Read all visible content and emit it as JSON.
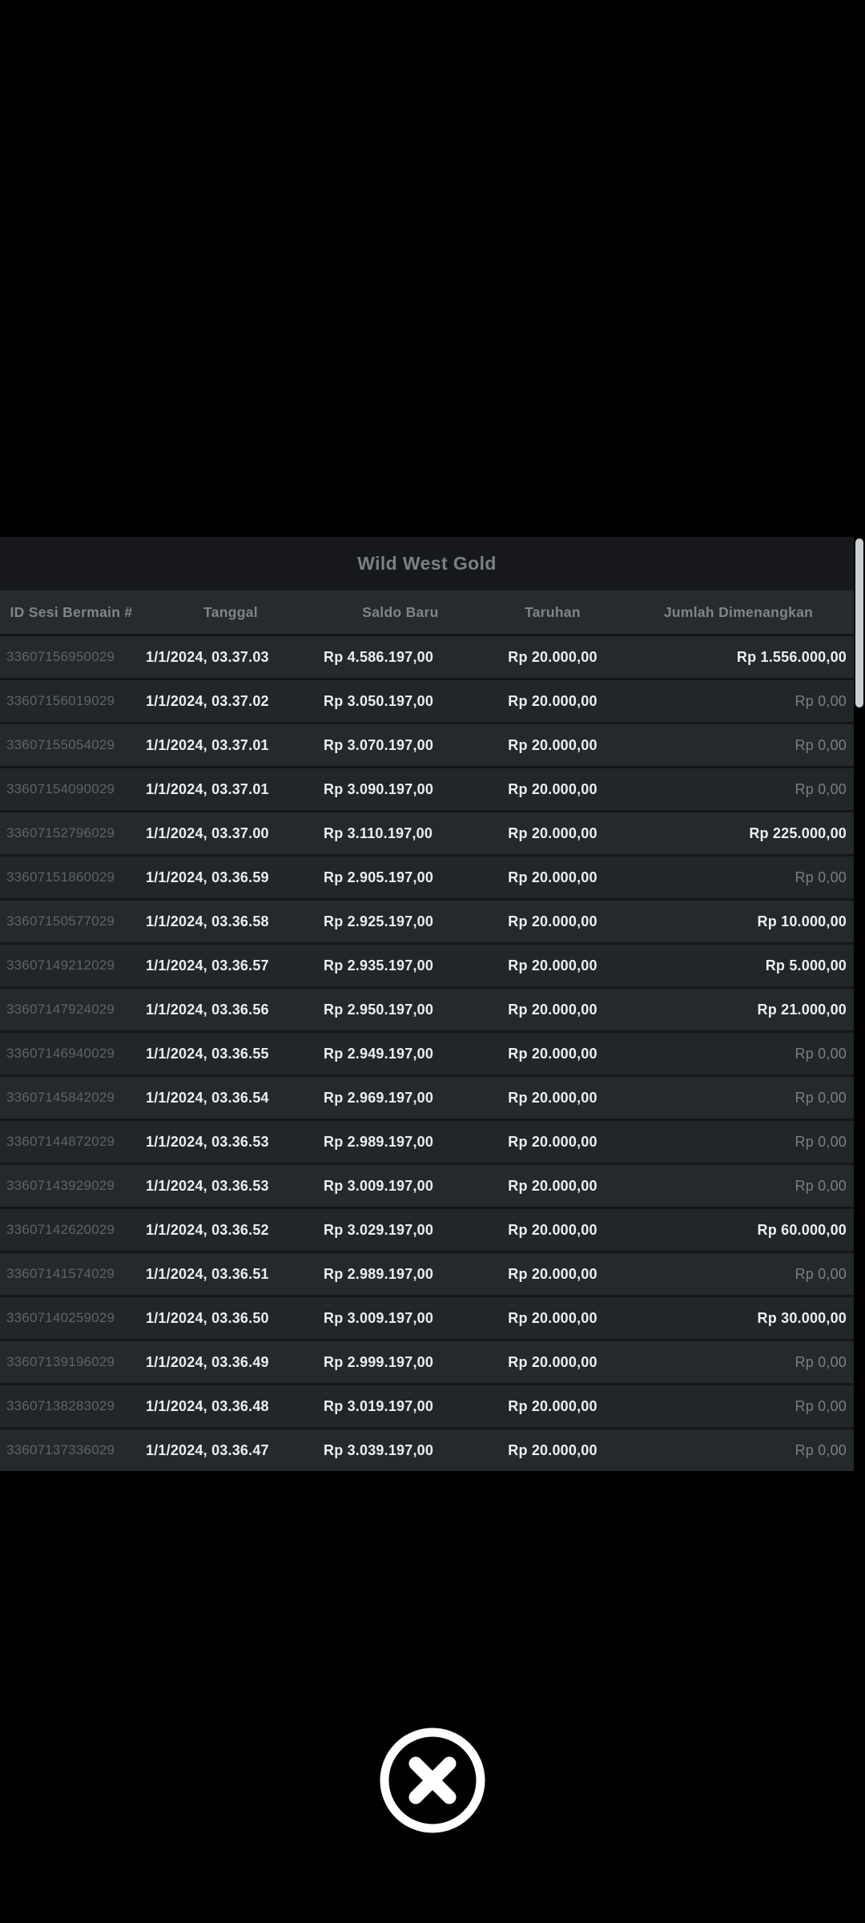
{
  "modal": {
    "title": "Wild West Gold",
    "columns": [
      "ID Sesi Bermain #",
      "Tanggal",
      "Saldo Baru",
      "Taruhan",
      "Jumlah Dimenangkan"
    ],
    "rows": [
      {
        "id": "33607156950029",
        "date": "1/1/2024, 03.37.03",
        "balance": "Rp 4.586.197,00",
        "bet": "Rp 20.000,00",
        "win": "Rp 1.556.000,00"
      },
      {
        "id": "33607156019029",
        "date": "1/1/2024, 03.37.02",
        "balance": "Rp 3.050.197,00",
        "bet": "Rp 20.000,00",
        "win": "Rp 0,00"
      },
      {
        "id": "33607155054029",
        "date": "1/1/2024, 03.37.01",
        "balance": "Rp 3.070.197,00",
        "bet": "Rp 20.000,00",
        "win": "Rp 0,00"
      },
      {
        "id": "33607154090029",
        "date": "1/1/2024, 03.37.01",
        "balance": "Rp 3.090.197,00",
        "bet": "Rp 20.000,00",
        "win": "Rp 0,00"
      },
      {
        "id": "33607152796029",
        "date": "1/1/2024, 03.37.00",
        "balance": "Rp 3.110.197,00",
        "bet": "Rp 20.000,00",
        "win": "Rp 225.000,00"
      },
      {
        "id": "33607151860029",
        "date": "1/1/2024, 03.36.59",
        "balance": "Rp 2.905.197,00",
        "bet": "Rp 20.000,00",
        "win": "Rp 0,00"
      },
      {
        "id": "33607150577029",
        "date": "1/1/2024, 03.36.58",
        "balance": "Rp 2.925.197,00",
        "bet": "Rp 20.000,00",
        "win": "Rp 10.000,00"
      },
      {
        "id": "33607149212029",
        "date": "1/1/2024, 03.36.57",
        "balance": "Rp 2.935.197,00",
        "bet": "Rp 20.000,00",
        "win": "Rp 5.000,00"
      },
      {
        "id": "33607147924029",
        "date": "1/1/2024, 03.36.56",
        "balance": "Rp 2.950.197,00",
        "bet": "Rp 20.000,00",
        "win": "Rp 21.000,00"
      },
      {
        "id": "33607146940029",
        "date": "1/1/2024, 03.36.55",
        "balance": "Rp 2.949.197,00",
        "bet": "Rp 20.000,00",
        "win": "Rp 0,00"
      },
      {
        "id": "33607145842029",
        "date": "1/1/2024, 03.36.54",
        "balance": "Rp 2.969.197,00",
        "bet": "Rp 20.000,00",
        "win": "Rp 0,00"
      },
      {
        "id": "33607144872029",
        "date": "1/1/2024, 03.36.53",
        "balance": "Rp 2.989.197,00",
        "bet": "Rp 20.000,00",
        "win": "Rp 0,00"
      },
      {
        "id": "33607143929029",
        "date": "1/1/2024, 03.36.53",
        "balance": "Rp 3.009.197,00",
        "bet": "Rp 20.000,00",
        "win": "Rp 0,00"
      },
      {
        "id": "33607142620029",
        "date": "1/1/2024, 03.36.52",
        "balance": "Rp 3.029.197,00",
        "bet": "Rp 20.000,00",
        "win": "Rp 60.000,00"
      },
      {
        "id": "33607141574029",
        "date": "1/1/2024, 03.36.51",
        "balance": "Rp 2.989.197,00",
        "bet": "Rp 20.000,00",
        "win": "Rp 0,00"
      },
      {
        "id": "33607140259029",
        "date": "1/1/2024, 03.36.50",
        "balance": "Rp 3.009.197,00",
        "bet": "Rp 20.000,00",
        "win": "Rp 30.000,00"
      },
      {
        "id": "33607139196029",
        "date": "1/1/2024, 03.36.49",
        "balance": "Rp 2.999.197,00",
        "bet": "Rp 20.000,00",
        "win": "Rp 0,00"
      },
      {
        "id": "33607138283029",
        "date": "1/1/2024, 03.36.48",
        "balance": "Rp 3.019.197,00",
        "bet": "Rp 20.000,00",
        "win": "Rp 0,00"
      },
      {
        "id": "33607137336029",
        "date": "1/1/2024, 03.36.47",
        "balance": "Rp 3.039.197,00",
        "bet": "Rp 20.000,00",
        "win": "Rp 0,00"
      }
    ],
    "zero_win_value": "Rp 0,00"
  },
  "icons": {
    "close": "circle-x"
  },
  "colors": {
    "page_bg": "#000000",
    "title_band_bg": "#16181c",
    "header_bg": "#252b2e",
    "row_odd": "#23292c",
    "row_even": "#202629",
    "text_primary": "#eceeef",
    "text_muted": "#787e82",
    "text_id": "#5d6468",
    "scrollbar_thumb": "#cdd0d1",
    "close_icon": "#ffffff"
  }
}
